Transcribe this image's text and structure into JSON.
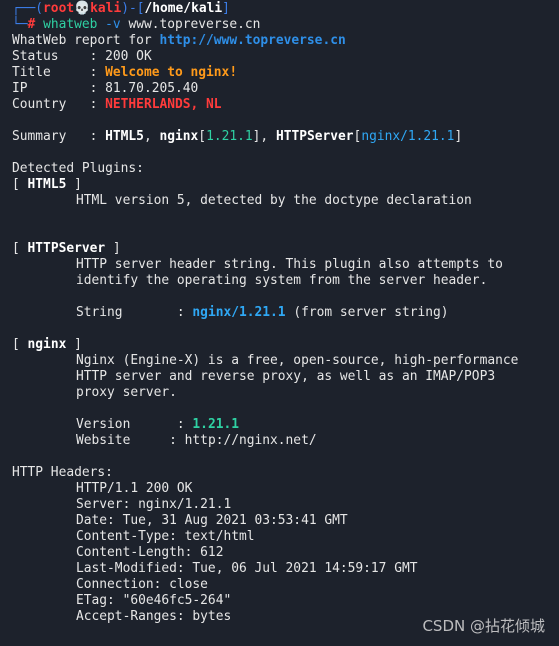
{
  "prompt": {
    "line1_open": "┌──(",
    "user": "root",
    "skull": "💀",
    "host": "kali",
    "line1_mid": ")-[",
    "path": "/home/kali",
    "line1_close": "]",
    "line2_prefix": "└─",
    "hash": "#",
    "cmd": "whatweb",
    "flag": "-v",
    "target": "www.topreverse.cn"
  },
  "report": {
    "header_label": "WhatWeb report for ",
    "url": "http://www.topreverse.cn",
    "status_label": "Status    : ",
    "status_value": "200 OK",
    "title_label": "Title     : ",
    "title_value": "Welcome to nginx!",
    "ip_label": "IP        : ",
    "ip_value": "81.70.205.40",
    "country_label": "Country   : ",
    "country_value": "NETHERLANDS, NL",
    "summary_label": "Summary   : ",
    "summary_html5": "HTML5",
    "summary_sep1": ", ",
    "summary_nginx": "nginx",
    "summary_nginx_ver": "1.21.1",
    "summary_sep2": "], ",
    "summary_server": "HTTPServer",
    "summary_server_val": "nginx/1.21.1"
  },
  "plugins": {
    "heading": "Detected Plugins:",
    "html5": {
      "name": "HTML5",
      "desc": "HTML version 5, detected by the doctype declaration"
    },
    "httpserver": {
      "name": "HTTPServer",
      "desc1": "HTTP server header string. This plugin also attempts to",
      "desc2": "identify the operating system from the server header.",
      "string_label": "String       : ",
      "string_value": "nginx/1.21.1",
      "string_note": " (from server string)"
    },
    "nginx": {
      "name": "nginx",
      "desc1": "Nginx (Engine-X) is a free, open-source, high-performance",
      "desc2": "HTTP server and reverse proxy, as well as an IMAP/POP3",
      "desc3": "proxy server.",
      "version_label": "Version      : ",
      "version_value": "1.21.1",
      "website_label": "Website     : ",
      "website_value": "http://nginx.net/"
    }
  },
  "http_headers": {
    "heading": "HTTP Headers:",
    "lines": [
      "HTTP/1.1 200 OK",
      "Server: nginx/1.21.1",
      "Date: Tue, 31 Aug 2021 03:53:41 GMT",
      "Content-Type: text/html",
      "Content-Length: 612",
      "Last-Modified: Tue, 06 Jul 2021 14:59:17 GMT",
      "Connection: close",
      "ETag: \"60e46fc5-264\"",
      "Accept-Ranges: bytes"
    ]
  },
  "watermark": "CSDN @拈花倾城"
}
